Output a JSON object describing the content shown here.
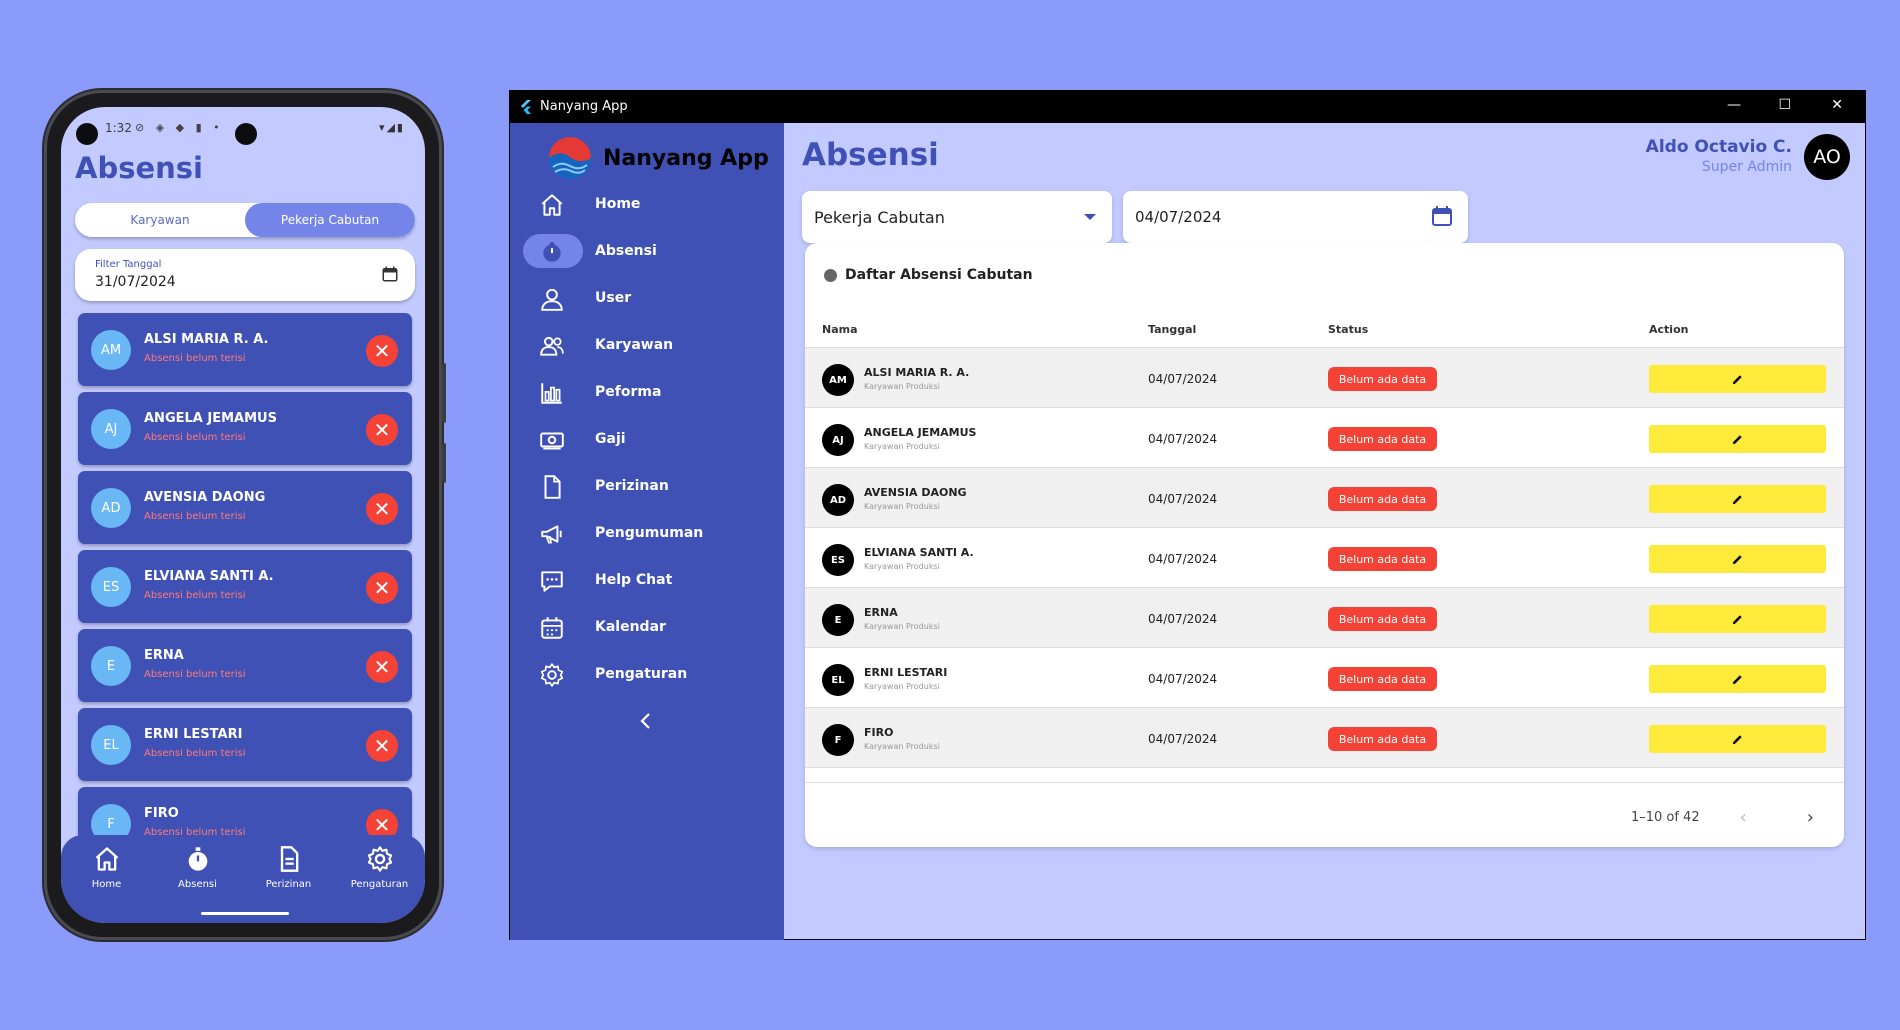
{
  "phone": {
    "status_time": "1:32",
    "title": "Absensi",
    "tabs": [
      {
        "label": "Karyawan",
        "active": false
      },
      {
        "label": "Pekerja Cabutan",
        "active": true
      }
    ],
    "filter": {
      "label": "Filter Tanggal",
      "value": "31/07/2024"
    },
    "employees": [
      {
        "initials": "AM",
        "name": "ALSI MARIA R. A.",
        "status": "Absensi belum terisi"
      },
      {
        "initials": "AJ",
        "name": "ANGELA JEMAMUS",
        "status": "Absensi belum terisi"
      },
      {
        "initials": "AD",
        "name": "AVENSIA DAONG",
        "status": "Absensi belum terisi"
      },
      {
        "initials": "ES",
        "name": "ELVIANA SANTI A.",
        "status": "Absensi belum terisi"
      },
      {
        "initials": "E",
        "name": "ERNA",
        "status": "Absensi belum terisi"
      },
      {
        "initials": "EL",
        "name": "ERNI LESTARI",
        "status": "Absensi belum terisi"
      },
      {
        "initials": "F",
        "name": "FIRO",
        "status": "Absensi belum terisi"
      }
    ],
    "nav": [
      {
        "label": "Home",
        "icon": "home-icon"
      },
      {
        "label": "Absensi",
        "icon": "stopwatch-icon"
      },
      {
        "label": "Perizinan",
        "icon": "document-icon"
      },
      {
        "label": "Pengaturan",
        "icon": "gear-icon"
      }
    ]
  },
  "desktop": {
    "window_title": "Nanyang App",
    "brand": "Nanyang App",
    "menu": [
      {
        "label": "Home",
        "icon": "home-icon",
        "active": false
      },
      {
        "label": "Absensi",
        "icon": "clock-icon",
        "active": true
      },
      {
        "label": "User",
        "icon": "user-icon",
        "active": false
      },
      {
        "label": "Karyawan",
        "icon": "users-icon",
        "active": false
      },
      {
        "label": "Peforma",
        "icon": "bar-chart-icon",
        "active": false
      },
      {
        "label": "Gaji",
        "icon": "money-icon",
        "active": false
      },
      {
        "label": "Perizinan",
        "icon": "document-icon",
        "active": false
      },
      {
        "label": "Pengumuman",
        "icon": "megaphone-icon",
        "active": false
      },
      {
        "label": "Help Chat",
        "icon": "chat-icon",
        "active": false
      },
      {
        "label": "Kalendar",
        "icon": "calendar-icon",
        "active": false
      },
      {
        "label": "Pengaturan",
        "icon": "gear-icon",
        "active": false
      }
    ],
    "page_title": "Absensi",
    "user": {
      "name": "Aldo Octavio C.",
      "role": "Super Admin",
      "initials": "AO"
    },
    "worker_type": "Pekerja Cabutan",
    "date": "04/07/2024",
    "card_title": "Daftar Absensi Cabutan",
    "columns": [
      "Nama",
      "Tanggal",
      "Status",
      "Action"
    ],
    "rows": [
      {
        "initials": "AM",
        "name": "ALSI MARIA R. A.",
        "role": "Karyawan Produksi",
        "date": "04/07/2024",
        "status": "Belum ada data"
      },
      {
        "initials": "AJ",
        "name": "ANGELA JEMAMUS",
        "role": "Karyawan Produksi",
        "date": "04/07/2024",
        "status": "Belum ada data"
      },
      {
        "initials": "AD",
        "name": "AVENSIA DAONG",
        "role": "Karyawan Produksi",
        "date": "04/07/2024",
        "status": "Belum ada data"
      },
      {
        "initials": "ES",
        "name": "ELVIANA SANTI A.",
        "role": "Karyawan Produksi",
        "date": "04/07/2024",
        "status": "Belum ada data"
      },
      {
        "initials": "E",
        "name": "ERNA",
        "role": "Karyawan Produksi",
        "date": "04/07/2024",
        "status": "Belum ada data"
      },
      {
        "initials": "EL",
        "name": "ERNI LESTARI",
        "role": "Karyawan Produksi",
        "date": "04/07/2024",
        "status": "Belum ada data"
      },
      {
        "initials": "F",
        "name": "FIRO",
        "role": "Karyawan Produksi",
        "date": "04/07/2024",
        "status": "Belum ada data"
      }
    ],
    "pagination": "1–10 of 42"
  },
  "colors": {
    "background": "#8b9bf9",
    "primary": "#3f51b5",
    "accent": "#7584e8",
    "surface": "#c3caff",
    "danger": "#f44336",
    "action": "#fdea3a"
  }
}
